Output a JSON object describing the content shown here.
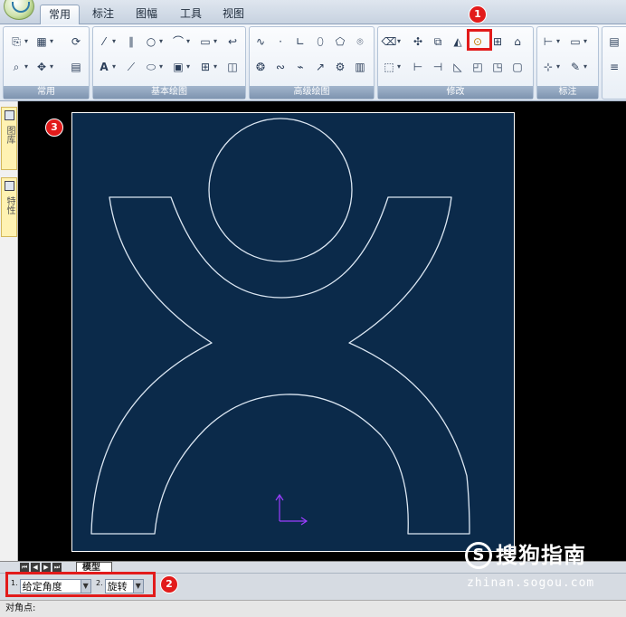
{
  "ribbon": {
    "tabs": [
      "常用",
      "标注",
      "图幅",
      "工具",
      "视图"
    ],
    "active_tab": "常用",
    "panels": [
      "常用",
      "基本绘图",
      "高级绘图",
      "修改",
      "标注"
    ]
  },
  "tools": {
    "rotate_icon": "rotate-icon",
    "highlight_color": "#e21b1b"
  },
  "badges": {
    "one": "1",
    "two": "2",
    "three": "3"
  },
  "left_palette": {
    "tab1": "图库",
    "tab2": "特性"
  },
  "drawing": {
    "background": "#0b2a4a",
    "line_color": "#dbe6f2",
    "ucs_color": "#9b3dff"
  },
  "layout": {
    "model_tab": "模型"
  },
  "options": {
    "opt1_index": "1.",
    "opt1_value": "给定角度",
    "opt2_index": "2.",
    "opt2_value": "旋转"
  },
  "status": {
    "prompt": "对角点:"
  },
  "watermark": {
    "logo": "S",
    "brand": "搜狗指南",
    "url": "zhinan.sogou.com"
  }
}
